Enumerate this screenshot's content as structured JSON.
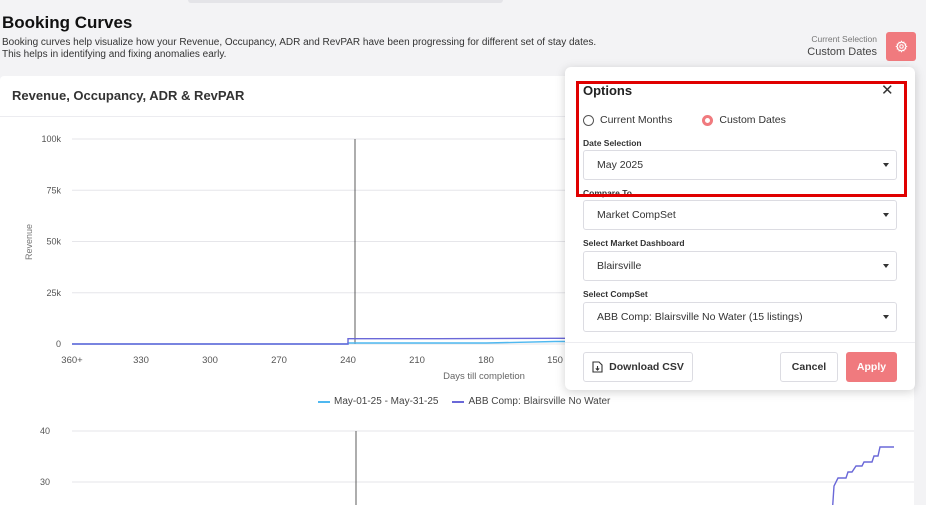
{
  "header": {
    "title": "Booking Curves",
    "description": "Booking curves help visualize how your Revenue, Occupancy, ADR and RevPAR have been progressing for different set of stay dates. This helps in identifying and fixing anomalies early.",
    "current_selection_label": "Current Selection",
    "current_selection_value": "Custom Dates"
  },
  "card": {
    "title": "Revenue, Occupancy, ADR & RevPAR"
  },
  "chart_data": [
    {
      "type": "line",
      "ylabel": "Revenue",
      "xlabel": "Days till completion",
      "yticks": [
        "100k",
        "75k",
        "50k",
        "25k",
        "0"
      ],
      "xticks": [
        "360+",
        "330",
        "300",
        "270",
        "240",
        "210",
        "180",
        "150"
      ],
      "ylim": [
        0,
        100000
      ],
      "series": [
        {
          "name": "May-01-25 - May-31-25",
          "color": "#4fb8f0",
          "x": [
            365,
            240,
            240,
            180,
            150,
            142
          ],
          "y": [
            0,
            0,
            500,
            500,
            1200,
            1200
          ]
        },
        {
          "name": "ABB Comp: Blairsville No Water",
          "color": "#6a68d8",
          "x": [
            365,
            240,
            240,
            200,
            150,
            142
          ],
          "y": [
            0,
            0,
            2600,
            2600,
            2800,
            2800
          ]
        }
      ],
      "grid": true
    },
    {
      "type": "line",
      "yticks": [
        "40",
        "30"
      ],
      "series": [
        {
          "name": "ABB Comp: Blairsville No Water",
          "color": "#6a68d8"
        }
      ]
    }
  ],
  "legend": [
    {
      "label": "May-01-25 - May-31-25",
      "color": "#4fb8f0"
    },
    {
      "label": "ABB Comp: Blairsville No Water",
      "color": "#6a68d8"
    }
  ],
  "options": {
    "title": "Options",
    "radio_current": "Current Months",
    "radio_custom": "Custom Dates",
    "selected": "Custom Dates",
    "date_selection_label": "Date Selection",
    "date_selection_value": "May 2025",
    "compare_to_label": "Compare To",
    "compare_to_value": "Market CompSet",
    "market_dashboard_label": "Select Market Dashboard",
    "market_dashboard_value": "Blairsville",
    "compset_label": "Select CompSet",
    "compset_value": "ABB Comp: Blairsville No Water (15 listings)",
    "download_label": "Download CSV",
    "cancel_label": "Cancel",
    "apply_label": "Apply"
  },
  "colors": {
    "accent": "#f07a7e",
    "series_1": "#4fb8f0",
    "series_2": "#6a68d8",
    "highlight": "#e00000"
  }
}
